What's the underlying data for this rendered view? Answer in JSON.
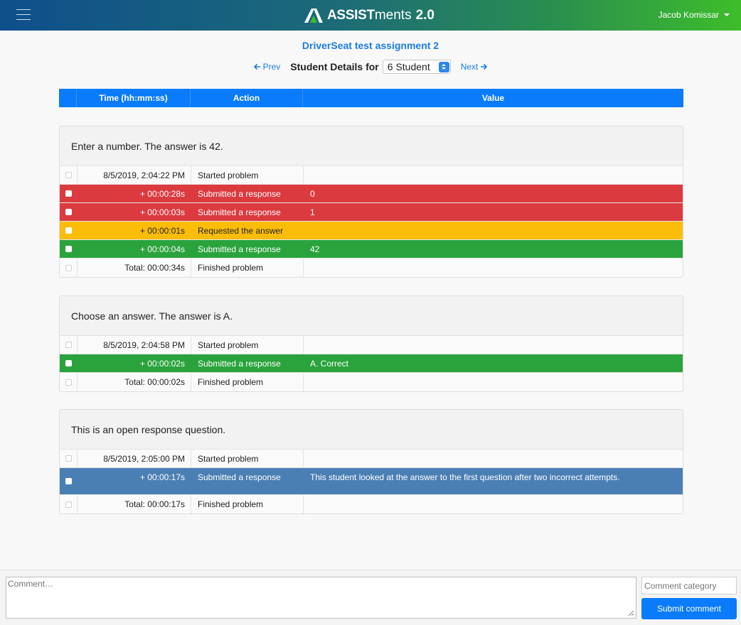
{
  "header": {
    "brand_bold": "ASSIST",
    "brand_light": "ments",
    "brand_version": "2.0",
    "user_name": "Jacob Komissar"
  },
  "assignment_title": "DriverSeat test assignment 2",
  "student_nav": {
    "prev_label": "Prev",
    "next_label": "Next",
    "details_label": "Student Details for",
    "selected_student": "6 Student"
  },
  "table_headers": {
    "time": "Time (hh:mm:ss)",
    "action": "Action",
    "value": "Value"
  },
  "problems": [
    {
      "title": "Enter a number. The answer is 42.",
      "rows": [
        {
          "time": "8/5/2019, 2:04:22 PM",
          "action": "Started problem",
          "value": "",
          "status": "plain"
        },
        {
          "time": "+ 00:00:28s",
          "action": "Submitted a response",
          "value": "0",
          "status": "red"
        },
        {
          "time": "+ 00:00:03s",
          "action": "Submitted a response",
          "value": "1",
          "status": "red"
        },
        {
          "time": "+ 00:00:01s",
          "action": "Requested the answer",
          "value": "",
          "status": "yellow"
        },
        {
          "time": "+ 00:00:04s",
          "action": "Submitted a response",
          "value": "42",
          "status": "green"
        },
        {
          "time": "Total: 00:00:34s",
          "action": "Finished problem",
          "value": "",
          "status": "plain"
        }
      ]
    },
    {
      "title": "Choose an answer. The answer is A.",
      "rows": [
        {
          "time": "8/5/2019, 2:04:58 PM",
          "action": "Started problem",
          "value": "",
          "status": "plain"
        },
        {
          "time": "+ 00:00:02s",
          "action": "Submitted a response",
          "value": "A. Correct",
          "status": "green"
        },
        {
          "time": "Total: 00:00:02s",
          "action": "Finished problem",
          "value": "",
          "status": "plain"
        }
      ]
    },
    {
      "title": "This is an open response question.",
      "rows": [
        {
          "time": "8/5/2019, 2:05:00 PM",
          "action": "Started problem",
          "value": "",
          "status": "plain"
        },
        {
          "time": "+ 00:00:17s",
          "action": "Submitted a response",
          "value": "This student looked at the answer to the first question after two incorrect attempts.",
          "status": "blue"
        },
        {
          "time": "Total: 00:00:17s",
          "action": "Finished problem",
          "value": "",
          "status": "plain"
        }
      ]
    }
  ],
  "comment": {
    "placeholder": "Comment…",
    "category_placeholder": "Comment category",
    "submit_label": "Submit comment"
  },
  "colors": {
    "accent": "#0a7bfa",
    "incorrect": "#db3a3f",
    "hint": "#fbbd09",
    "correct": "#2aa33c",
    "open_response": "#4a7fb4"
  }
}
